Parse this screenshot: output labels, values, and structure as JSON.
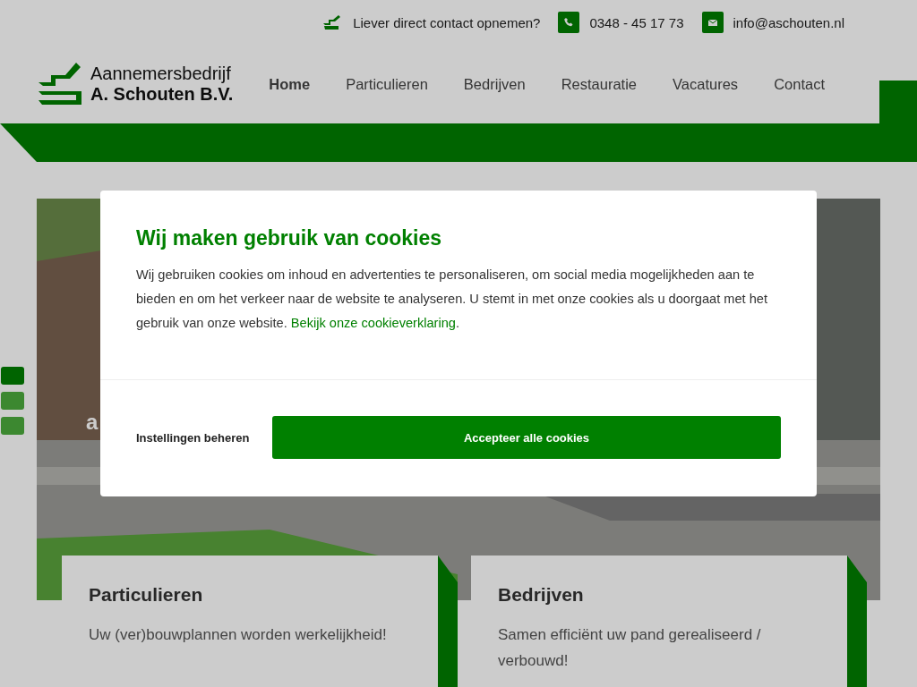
{
  "topbar": {
    "contact_prompt": "Liever direct contact opnemen?",
    "phone": "0348 - 45 17 73",
    "email": "info@aschouten.nl"
  },
  "logo": {
    "line1": "Aannemersbedrijf",
    "line2": "A. Schouten B.V."
  },
  "nav": [
    {
      "label": "Home",
      "selected": true
    },
    {
      "label": "Particulieren",
      "selected": false
    },
    {
      "label": "Bedrijven",
      "selected": false
    },
    {
      "label": "Restauratie",
      "selected": false
    },
    {
      "label": "Vacatures",
      "selected": false
    },
    {
      "label": "Contact",
      "selected": false
    }
  ],
  "hero": {
    "subtitle": "a",
    "slides": [
      {
        "selected": true
      },
      {
        "selected": false
      },
      {
        "selected": false
      }
    ]
  },
  "cards": [
    {
      "title": "Particulieren",
      "text": "Uw (ver)bouwplannen worden werkelijkheid!"
    },
    {
      "title": "Bedrijven",
      "text": "Samen efficiënt uw pand gerealiseerd / verbouwd!"
    }
  ],
  "cookie_dialog": {
    "title": "Wij maken gebruik van cookies",
    "text": "Wij gebruiken cookies om inhoud en advertenties te personaliseren, om social media mogelijkheden aan te bieden en om het verkeer naar de website te analyseren. U stemt in met onze cookies als u doorgaat met het gebruik van onze website.",
    "link": "Bekijk onze cookieverklaring",
    "after_link": ".",
    "settings_button": "Instellingen beheren",
    "accept_button": "Accepteer alle cookies"
  }
}
